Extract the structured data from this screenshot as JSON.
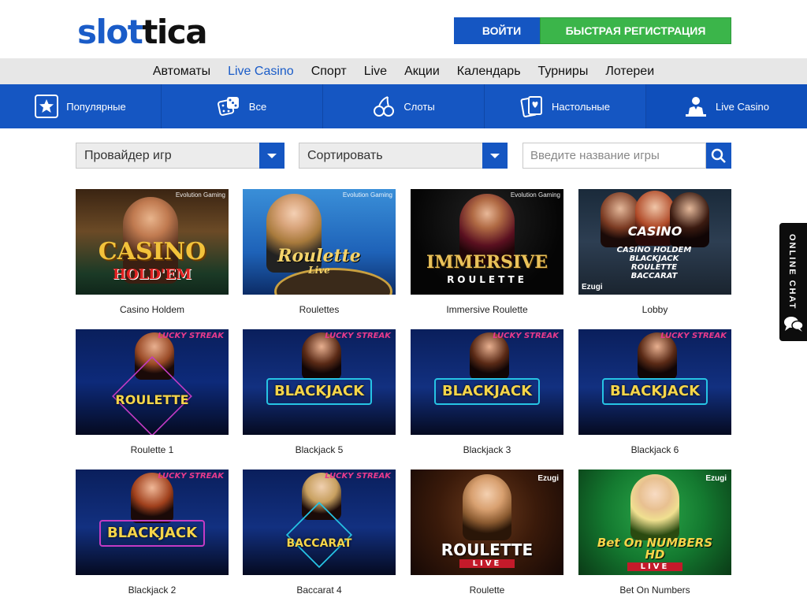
{
  "brand": {
    "logo_part1": "slot",
    "logo_part2": "tica",
    "accent": "#1556c2",
    "green": "#3bb54a"
  },
  "header": {
    "login": "ВОЙТИ",
    "register": "БЫСТРАЯ РЕГИСТРАЦИЯ"
  },
  "topnav": [
    "Автоматы",
    "Live Casino",
    "Спорт",
    "Live",
    "Акции",
    "Календарь",
    "Турниры",
    "Лотереи"
  ],
  "topnav_active": "Live Casino",
  "categories": [
    {
      "label": "Популярные",
      "icon": "star-icon"
    },
    {
      "label": "Все",
      "icon": "dice-icon"
    },
    {
      "label": "Слоты",
      "icon": "cherries-icon"
    },
    {
      "label": "Настольные",
      "icon": "cards-icon"
    },
    {
      "label": "Live Casino",
      "icon": "dealer-icon"
    }
  ],
  "filters": {
    "provider": "Провайдер игр",
    "sort": "Сортировать",
    "search_placeholder": "Введите название игры"
  },
  "games": [
    {
      "title": "Casino Holdem",
      "art": "CASINO",
      "art2": "HOLD'EM",
      "badge": "Evolution Gaming"
    },
    {
      "title": "Roulettes",
      "art": "Roulette",
      "art2": "Live",
      "badge": "Evolution Gaming"
    },
    {
      "title": "Immersive Roulette",
      "art": "IMMERSIVE",
      "art2": "ROULETTE",
      "badge": "Evolution Gaming"
    },
    {
      "title": "Lobby",
      "art": "CASINO",
      "art2": "CASINO HOLDEM BLACKJACK ROULETTE BACCARAT",
      "badge": "Ezugi"
    },
    {
      "title": "Roulette 1",
      "art": "ROULETTE",
      "badge": "LUCKY STREAK"
    },
    {
      "title": "Blackjack 5",
      "art": "BLACKJACK",
      "badge": "LUCKY STREAK"
    },
    {
      "title": "Blackjack 3",
      "art": "BLACKJACK",
      "badge": "LUCKY STREAK"
    },
    {
      "title": "Blackjack 6",
      "art": "BLACKJACK",
      "badge": "LUCKY STREAK"
    },
    {
      "title": "Blackjack 2",
      "art": "BLACKJACK",
      "badge": "LUCKY STREAK"
    },
    {
      "title": "Baccarat 4",
      "art": "BACCARAT",
      "badge": "LUCKY STREAK"
    },
    {
      "title": "Roulette",
      "art": "ROULETTE",
      "art2": "LIVE",
      "badge": "Ezugi"
    },
    {
      "title": "Bet On Numbers",
      "art": "Bet On NUMBERS HD",
      "art2": "LIVE",
      "badge": "Ezugi"
    }
  ],
  "chat": {
    "label": "ONLINE CHAT"
  }
}
